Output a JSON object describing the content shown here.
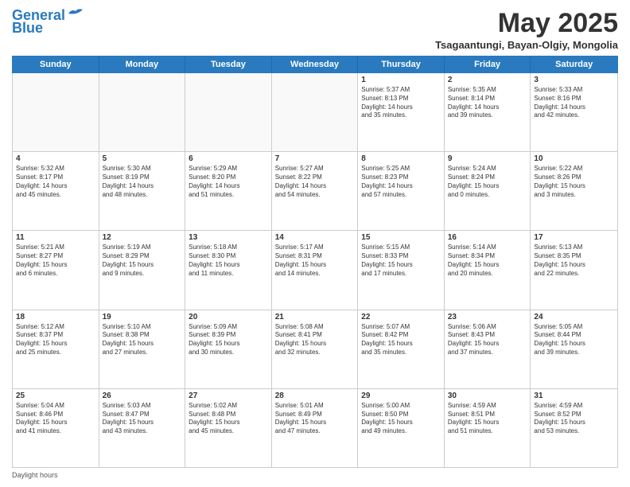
{
  "header": {
    "logo_line1": "General",
    "logo_line2": "Blue",
    "month": "May 2025",
    "location": "Tsagaantungi, Bayan-Olgiy, Mongolia"
  },
  "days_of_week": [
    "Sunday",
    "Monday",
    "Tuesday",
    "Wednesday",
    "Thursday",
    "Friday",
    "Saturday"
  ],
  "footer": "Daylight hours",
  "weeks": [
    [
      {
        "day": "",
        "text": ""
      },
      {
        "day": "",
        "text": ""
      },
      {
        "day": "",
        "text": ""
      },
      {
        "day": "",
        "text": ""
      },
      {
        "day": "1",
        "text": "Sunrise: 5:37 AM\nSunset: 8:13 PM\nDaylight: 14 hours\nand 35 minutes."
      },
      {
        "day": "2",
        "text": "Sunrise: 5:35 AM\nSunset: 8:14 PM\nDaylight: 14 hours\nand 39 minutes."
      },
      {
        "day": "3",
        "text": "Sunrise: 5:33 AM\nSunset: 8:16 PM\nDaylight: 14 hours\nand 42 minutes."
      }
    ],
    [
      {
        "day": "4",
        "text": "Sunrise: 5:32 AM\nSunset: 8:17 PM\nDaylight: 14 hours\nand 45 minutes."
      },
      {
        "day": "5",
        "text": "Sunrise: 5:30 AM\nSunset: 8:19 PM\nDaylight: 14 hours\nand 48 minutes."
      },
      {
        "day": "6",
        "text": "Sunrise: 5:29 AM\nSunset: 8:20 PM\nDaylight: 14 hours\nand 51 minutes."
      },
      {
        "day": "7",
        "text": "Sunrise: 5:27 AM\nSunset: 8:22 PM\nDaylight: 14 hours\nand 54 minutes."
      },
      {
        "day": "8",
        "text": "Sunrise: 5:25 AM\nSunset: 8:23 PM\nDaylight: 14 hours\nand 57 minutes."
      },
      {
        "day": "9",
        "text": "Sunrise: 5:24 AM\nSunset: 8:24 PM\nDaylight: 15 hours\nand 0 minutes."
      },
      {
        "day": "10",
        "text": "Sunrise: 5:22 AM\nSunset: 8:26 PM\nDaylight: 15 hours\nand 3 minutes."
      }
    ],
    [
      {
        "day": "11",
        "text": "Sunrise: 5:21 AM\nSunset: 8:27 PM\nDaylight: 15 hours\nand 6 minutes."
      },
      {
        "day": "12",
        "text": "Sunrise: 5:19 AM\nSunset: 8:29 PM\nDaylight: 15 hours\nand 9 minutes."
      },
      {
        "day": "13",
        "text": "Sunrise: 5:18 AM\nSunset: 8:30 PM\nDaylight: 15 hours\nand 11 minutes."
      },
      {
        "day": "14",
        "text": "Sunrise: 5:17 AM\nSunset: 8:31 PM\nDaylight: 15 hours\nand 14 minutes."
      },
      {
        "day": "15",
        "text": "Sunrise: 5:15 AM\nSunset: 8:33 PM\nDaylight: 15 hours\nand 17 minutes."
      },
      {
        "day": "16",
        "text": "Sunrise: 5:14 AM\nSunset: 8:34 PM\nDaylight: 15 hours\nand 20 minutes."
      },
      {
        "day": "17",
        "text": "Sunrise: 5:13 AM\nSunset: 8:35 PM\nDaylight: 15 hours\nand 22 minutes."
      }
    ],
    [
      {
        "day": "18",
        "text": "Sunrise: 5:12 AM\nSunset: 8:37 PM\nDaylight: 15 hours\nand 25 minutes."
      },
      {
        "day": "19",
        "text": "Sunrise: 5:10 AM\nSunset: 8:38 PM\nDaylight: 15 hours\nand 27 minutes."
      },
      {
        "day": "20",
        "text": "Sunrise: 5:09 AM\nSunset: 8:39 PM\nDaylight: 15 hours\nand 30 minutes."
      },
      {
        "day": "21",
        "text": "Sunrise: 5:08 AM\nSunset: 8:41 PM\nDaylight: 15 hours\nand 32 minutes."
      },
      {
        "day": "22",
        "text": "Sunrise: 5:07 AM\nSunset: 8:42 PM\nDaylight: 15 hours\nand 35 minutes."
      },
      {
        "day": "23",
        "text": "Sunrise: 5:06 AM\nSunset: 8:43 PM\nDaylight: 15 hours\nand 37 minutes."
      },
      {
        "day": "24",
        "text": "Sunrise: 5:05 AM\nSunset: 8:44 PM\nDaylight: 15 hours\nand 39 minutes."
      }
    ],
    [
      {
        "day": "25",
        "text": "Sunrise: 5:04 AM\nSunset: 8:46 PM\nDaylight: 15 hours\nand 41 minutes."
      },
      {
        "day": "26",
        "text": "Sunrise: 5:03 AM\nSunset: 8:47 PM\nDaylight: 15 hours\nand 43 minutes."
      },
      {
        "day": "27",
        "text": "Sunrise: 5:02 AM\nSunset: 8:48 PM\nDaylight: 15 hours\nand 45 minutes."
      },
      {
        "day": "28",
        "text": "Sunrise: 5:01 AM\nSunset: 8:49 PM\nDaylight: 15 hours\nand 47 minutes."
      },
      {
        "day": "29",
        "text": "Sunrise: 5:00 AM\nSunset: 8:50 PM\nDaylight: 15 hours\nand 49 minutes."
      },
      {
        "day": "30",
        "text": "Sunrise: 4:59 AM\nSunset: 8:51 PM\nDaylight: 15 hours\nand 51 minutes."
      },
      {
        "day": "31",
        "text": "Sunrise: 4:59 AM\nSunset: 8:52 PM\nDaylight: 15 hours\nand 53 minutes."
      }
    ]
  ]
}
